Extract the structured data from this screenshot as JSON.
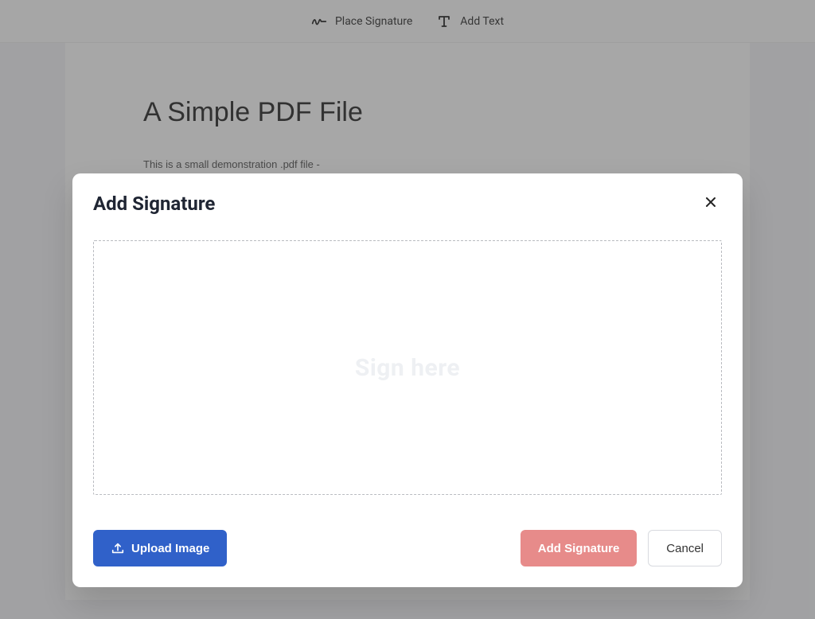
{
  "toolbar": {
    "place_signature_label": "Place Signature",
    "add_text_label": "Add Text"
  },
  "pdf": {
    "title": "A Simple PDF File",
    "body_line_1": "This is a small demonstration .pdf file -"
  },
  "modal": {
    "title": "Add Signature",
    "sign_placeholder": "Sign here",
    "upload_label": "Upload Image",
    "add_signature_label": "Add Signature",
    "cancel_label": "Cancel"
  }
}
